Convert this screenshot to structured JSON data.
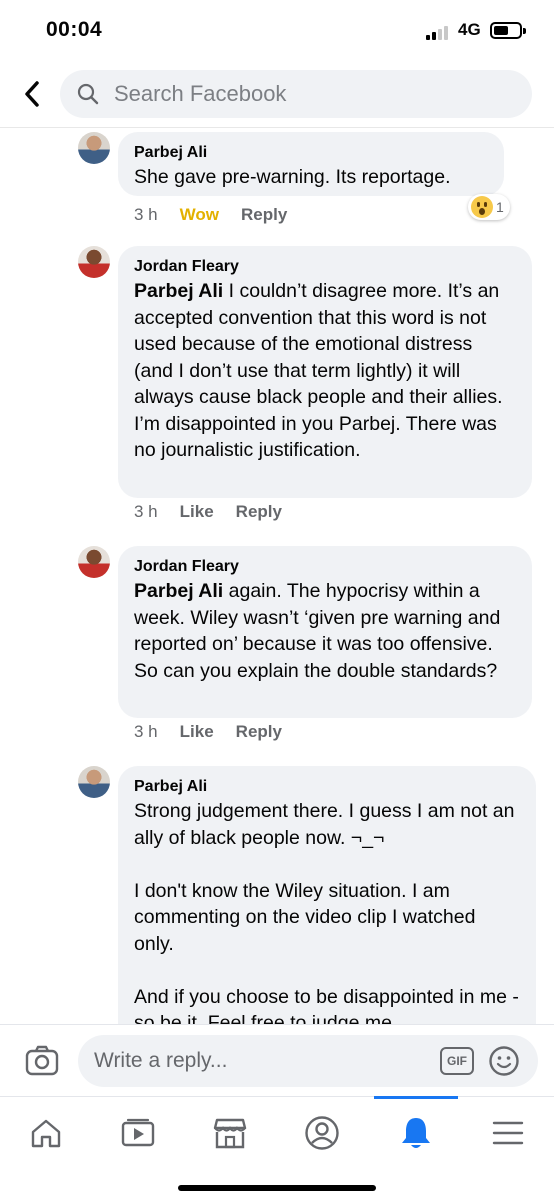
{
  "status_bar": {
    "time": "00:04",
    "network": "4G"
  },
  "search": {
    "placeholder": "Search Facebook"
  },
  "comments": [
    {
      "author": "Parbej Ali",
      "mention": "",
      "text": "She gave pre-warning. Its reportage.",
      "time": "3 h",
      "reaction_label": "Wow",
      "reply_label": "Reply",
      "reaction_count": "1"
    },
    {
      "author": "Jordan Fleary",
      "mention": "Parbej Ali",
      "text": " I couldn’t disagree more. It’s an accepted convention that this word is not used because of the emotional distress (and I don’t use that term lightly) it will always cause black people and their allies. I’m disappointed in you Parbej. There was no journalistic justification.",
      "time": "3 h",
      "reaction_label": "Like",
      "reply_label": "Reply"
    },
    {
      "author": "Jordan Fleary",
      "mention": "Parbej Ali",
      "text": " again. The hypocrisy within a week. Wiley wasn’t ‘given pre warning and reported on’ because it was too offensive. So can you explain the double standards?",
      "time": "3 h",
      "reaction_label": "Like",
      "reply_label": "Reply"
    },
    {
      "author": "Parbej Ali",
      "mention": "",
      "text": "Strong judgement there. I guess I am not an ally of black people now. ¬_¬\n\nI don't know the Wiley situation. I am commenting on the video clip I watched only.\n\nAnd if you choose to be disappointed in me - so be it. Feel free to judge me",
      "time": "",
      "reaction_label": "",
      "reply_label": ""
    }
  ],
  "reply_bar": {
    "placeholder": "Write a reply...",
    "gif_label": "GIF"
  },
  "bottom_nav": {
    "items": [
      "home-icon",
      "watch-icon",
      "marketplace-icon",
      "profile-icon",
      "notifications-icon",
      "menu-icon"
    ],
    "active": "notifications-icon"
  },
  "colors": {
    "accent": "#1877f2",
    "bubble": "#f0f2f5",
    "muted": "#65676b",
    "wow": "#e3b100"
  }
}
